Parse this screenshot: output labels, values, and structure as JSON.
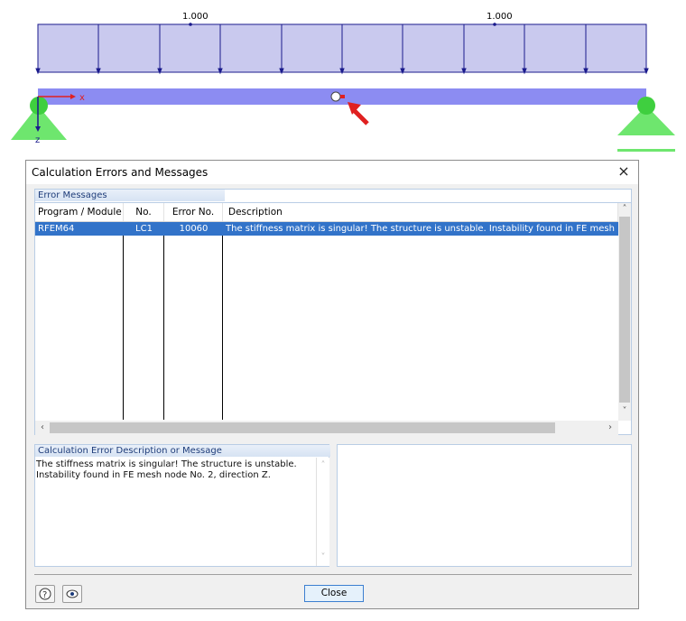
{
  "structure": {
    "load_value_left": "1.000",
    "load_value_right": "1.000",
    "axis_x": "x",
    "axis_z": "z",
    "colors": {
      "load_fill": "#c9c9ee",
      "load_line": "#1a1a8c",
      "beam": "#8c8cf2",
      "support": "#5fd95f",
      "arrow": "#e02020"
    }
  },
  "dialog": {
    "title": "Calculation Errors and Messages",
    "close_icon": "×",
    "error_group_title": "Error Messages",
    "columns": [
      "Program / Module",
      "No.",
      "Error No.",
      "Description"
    ],
    "rows": [
      {
        "program": "RFEM64",
        "no": "LC1",
        "error_no": "10060",
        "description": "The stiffness matrix is singular! The structure is unstable. Instability found in FE mesh node No. 2, direction Z."
      }
    ],
    "desc_group_title": "Calculation Error Description or Message",
    "desc_text": "The stiffness matrix is singular! The structure is unstable. Instability found in FE mesh node No. 2, direction Z.",
    "close_button": "Close",
    "help_icon": "help-icon",
    "view_icon": "eye-icon"
  }
}
